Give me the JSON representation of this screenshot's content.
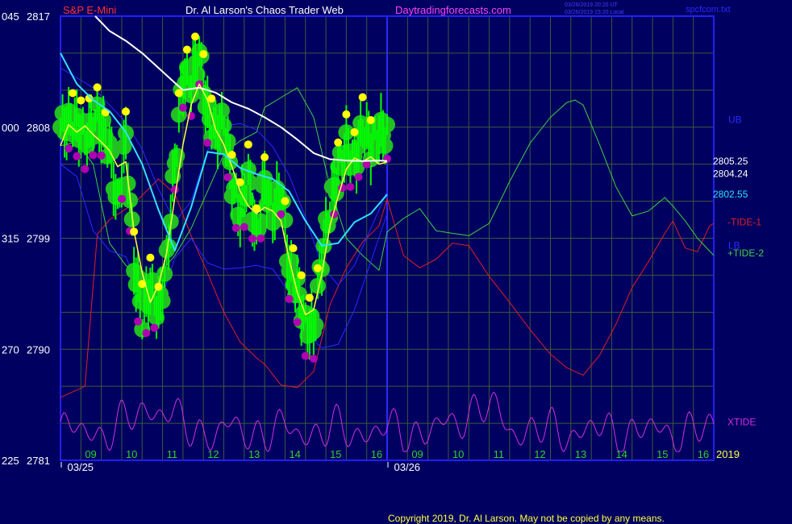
{
  "header": {
    "instrument": "S&P E-Mini",
    "author": "Dr. Al Larson's Chaos Trader Web",
    "site": "Daytradingforecasts.com",
    "timestamp_utc": "03/26/2019 20:20 UT",
    "timestamp_local": "03/26/2019 15:20 Local",
    "file": "spcfcom.txt"
  },
  "footer": {
    "copyright": "Copyright 2019, Dr. Al Larson. May not be copied by any means."
  },
  "colors": {
    "background": "#000060",
    "grid": "#3c5a3c",
    "frame": "#2020ff",
    "price_bars": "#00ff00",
    "price_glow": "#22c022",
    "high_dots": "#ffff00",
    "low_dots": "#b000b0",
    "ma_white": "#ffffff",
    "ma_cyan": "#30e0ff",
    "ma_yellow": "#ffff40",
    "band": "#2a2aff",
    "tide1": "#e02020",
    "tide2": "#40d040",
    "xtide": "#d030e0"
  },
  "chart_data": {
    "type": "line",
    "title": "S&P E-Mini",
    "ylim": [
      2781,
      2817
    ],
    "y_ticks": [
      {
        "left": "045",
        "right": "2817",
        "value": 2817
      },
      {
        "left": "000",
        "right": "2808",
        "value": 2808
      },
      {
        "left": "315",
        "right": "2799",
        "value": 2799
      },
      {
        "left": "270",
        "right": "2790",
        "value": 2790
      },
      {
        "left": "225",
        "right": "2781",
        "value": 2781
      }
    ],
    "xlim": [
      0,
      16
    ],
    "hour_ticks": [
      {
        "label": "09",
        "x": 1
      },
      {
        "label": "10",
        "x": 2
      },
      {
        "label": "11",
        "x": 3
      },
      {
        "label": "12",
        "x": 4
      },
      {
        "label": "13",
        "x": 5
      },
      {
        "label": "14",
        "x": 6
      },
      {
        "label": "15",
        "x": 7
      },
      {
        "label": "16",
        "x": 8
      },
      {
        "label": "09",
        "x": 9
      },
      {
        "label": "10",
        "x": 10
      },
      {
        "label": "11",
        "x": 11
      },
      {
        "label": "12",
        "x": 12
      },
      {
        "label": "13",
        "x": 13
      },
      {
        "label": "14",
        "x": 14
      },
      {
        "label": "15",
        "x": 15
      },
      {
        "label": "16",
        "x": 16
      }
    ],
    "date_labels": [
      {
        "label": "03/25",
        "x": 0.8
      },
      {
        "label": "03/26",
        "x": 8.8
      }
    ],
    "day_divider_x": 8,
    "year_label": "2019",
    "right_labels": [
      {
        "text": "UB",
        "value": 2808.6
      },
      {
        "text": "2805.25",
        "value": 2805.25
      },
      {
        "text": "2804.24",
        "value": 2804.24
      },
      {
        "text": "2802.55",
        "value": 2802.55
      },
      {
        "text": "-TIDE-1",
        "value": 2800.3
      },
      {
        "text": "LB",
        "value": 2798.4
      },
      {
        "text": "+TIDE-2",
        "value": 2797.8
      },
      {
        "text": "XTIDE",
        "value": 2784.1
      }
    ],
    "series": [
      {
        "name": "price",
        "x": [
          0,
          0.3,
          0.6,
          0.9,
          1.2,
          1.4,
          1.6,
          1.8,
          2.0,
          2.2,
          2.4,
          2.6,
          2.8,
          3.0,
          3.2,
          3.4,
          3.6,
          3.8,
          4.0,
          4.2,
          4.4,
          4.6,
          4.8,
          5.0,
          5.2,
          5.4,
          5.6,
          5.8,
          6.0,
          6.2,
          6.4,
          6.6,
          6.8,
          7.0,
          7.2,
          7.4,
          7.6,
          7.8,
          8.0
        ],
        "values": [
          2808,
          2808.5,
          2807.2,
          2808.8,
          2806.3,
          2801.5,
          2807,
          2797,
          2792.7,
          2795,
          2793,
          2797,
          2805,
          2812,
          2811.5,
          2814,
          2809,
          2807.5,
          2808.5,
          2803.5,
          2801,
          2804,
          2799,
          2803.5,
          2801,
          2803,
          2796.5,
          2794.8,
          2792,
          2791.5,
          2797.5,
          2801.5,
          2804.5,
          2806.5,
          2805,
          2808,
          2806.5,
          2807.5,
          2807.5
        ]
      },
      {
        "name": "",
        "x": [
          0,
          0.2,
          0.4,
          0.6,
          0.8,
          1.0,
          1.2,
          1.4,
          1.6,
          1.8,
          2.0,
          2.2,
          2.4,
          2.6,
          2.8,
          3.0,
          3.2,
          3.4,
          3.6,
          3.8,
          4.0,
          4.2,
          4.4,
          4.6,
          4.8,
          5.0,
          5.2,
          5.4,
          5.6,
          5.8,
          6.0,
          6.2,
          6.4,
          6.6,
          6.8,
          7.0,
          7.2,
          7.4,
          7.6,
          7.8,
          8.0
        ],
        "values": [
          2806.5,
          2808.2,
          2807.6,
          2808.1,
          2807.4,
          2806.8,
          2806.1,
          2804.8,
          2805.2,
          2799.6,
          2796.2,
          2793.8,
          2795.2,
          2797.8,
          2802.3,
          2806.6,
          2809.8,
          2811.5,
          2810.2,
          2807.8,
          2806.6,
          2804.8,
          2802.8,
          2801.6,
          2801.0,
          2801.5,
          2801.2,
          2800.4,
          2797.3,
          2794.6,
          2792.8,
          2793.2,
          2796.1,
          2800.0,
          2802.4,
          2804.6,
          2805.5,
          2805.2,
          2805.6,
          2805.0,
          2805.2
        ]
      },
      {
        "name": "",
        "x": [
          0,
          0.4,
          0.8,
          1.2,
          1.6,
          2.0,
          2.4,
          2.8,
          3.2,
          3.6,
          4.0,
          4.4,
          4.8,
          5.2,
          5.6,
          6.0,
          6.4,
          6.8,
          7.2,
          7.6,
          8.0
        ],
        "values": [
          2814,
          2811.5,
          2810.2,
          2809.3,
          2807.6,
          2805.0,
          2801.3,
          2798.0,
          2801.5,
          2806.0,
          2805.8,
          2804.7,
          2804.2,
          2803.8,
          2802.8,
          2800.4,
          2798.4,
          2798.6,
          2800.3,
          2801.0,
          2802.55
        ]
      },
      {
        "name": "",
        "x": [
          0.85,
          1.2,
          1.6,
          2.0,
          2.4,
          2.8,
          3.0,
          3.4,
          3.8,
          4.2,
          4.6,
          5.0,
          5.4,
          5.8,
          6.2,
          6.6,
          7.0,
          7.4,
          7.8,
          8.0
        ],
        "values": [
          2817,
          2815.8,
          2815.0,
          2814.0,
          2812.8,
          2811.6,
          2811.0,
          2811.2,
          2810.8,
          2810.0,
          2809.5,
          2808.8,
          2808.0,
          2807.0,
          2805.9,
          2805.4,
          2805.3,
          2805.25,
          2805.3,
          2805.25
        ]
      },
      {
        "name": "",
        "x": [
          0,
          0.4,
          0.8,
          1.2,
          1.6,
          2.0,
          2.4,
          2.8,
          3.2,
          3.6,
          4.0,
          4.4,
          4.8,
          5.2,
          5.6,
          6.0,
          6.4,
          6.8,
          7.2,
          7.6,
          8.0
        ],
        "values": [
          2812.8,
          2812.0,
          2811.2,
          2809.8,
          2808.4,
          2806.2,
          2803.0,
          2800.3,
          2802.0,
          2806.1,
          2808.1,
          2808.3,
          2807.8,
          2806.4,
          2804.1,
          2800.7,
          2796.8,
          2795.2,
          2796.8,
          2799.8,
          2802.8
        ]
      },
      {
        "name": "",
        "x": [
          0,
          0.4,
          0.8,
          1.2,
          1.6,
          2.0,
          2.4,
          2.8,
          3.2,
          3.6,
          4.0,
          4.4,
          4.8,
          5.2,
          5.6,
          6.0,
          6.4,
          6.8,
          7.2,
          7.6,
          8.0
        ],
        "values": [
          2805.0,
          2804.0,
          2799.6,
          2798.0,
          2797.5,
          2794.4,
          2793.3,
          2797.4,
          2799.0,
          2797.0,
          2796.5,
          2796.6,
          2796.8,
          2796.5,
          2794.6,
          2791.4,
          2790.1,
          2790.4,
          2793.2,
          2797.1,
          2801.0
        ]
      },
      {
        "name": "-TIDE-1",
        "x": [
          0,
          0.6,
          0.9,
          1.2,
          1.8,
          2.4,
          2.8,
          3.2,
          3.6,
          4.0,
          4.4,
          4.8,
          5.0,
          5.4,
          5.8,
          6.2,
          6.6,
          7.0,
          7.4,
          7.8,
          8.0,
          8.4,
          8.8,
          9.2,
          9.6,
          10.0,
          10.5,
          11.0,
          11.5,
          12.0,
          12.4,
          12.8,
          13.2,
          13.6,
          14.0,
          14.4,
          14.8,
          15.0,
          15.3,
          15.6,
          15.9,
          16.0
        ],
        "values": [
          2786.1,
          2787.0,
          2799.3,
          2800.5,
          2801.8,
          2803.8,
          2802.6,
          2799.2,
          2796.2,
          2793.0,
          2790.6,
          2789.3,
          2788.8,
          2787.1,
          2786.9,
          2788.2,
          2793.6,
          2796.6,
          2798.7,
          2800.0,
          2802.2,
          2797.6,
          2796.6,
          2797.3,
          2798.6,
          2798.4,
          2795.9,
          2793.8,
          2791.6,
          2789.6,
          2788.5,
          2787.9,
          2789.5,
          2792.0,
          2795.0,
          2797.1,
          2799.4,
          2800.4,
          2798.2,
          2797.9,
          2800.0,
          2800.2
        ]
      },
      {
        "name": "+TIDE-2",
        "x": [
          0,
          0.4,
          0.8,
          1.2,
          1.6,
          2.0,
          2.4,
          2.8,
          3.2,
          3.6,
          4.0,
          4.4,
          4.8,
          5.0,
          5.4,
          5.8,
          6.2,
          6.6,
          7.0,
          7.4,
          7.8,
          8.0,
          8.4,
          8.8,
          9.2,
          9.6,
          10.0,
          10.5,
          11.0,
          11.5,
          12.0,
          12.4,
          12.6,
          12.8,
          13.2,
          13.6,
          14.0,
          14.4,
          14.8,
          15.0,
          15.3,
          15.6,
          16.0
        ],
        "values": [
          2806.5,
          2806.8,
          2805.0,
          2798.6,
          2796.8,
          2795.9,
          2796.0,
          2797.6,
          2799.8,
          2802.8,
          2805.8,
          2806.9,
          2807.6,
          2809.6,
          2810.4,
          2811.2,
          2808.8,
          2803.2,
          2799.0,
          2797.6,
          2796.4,
          2799.5,
          2800.6,
          2801.4,
          2799.6,
          2799.4,
          2799.2,
          2800.2,
          2803.6,
          2806.7,
          2808.8,
          2810.0,
          2810.2,
          2809.8,
          2806.6,
          2803.2,
          2800.8,
          2801.2,
          2802.3,
          2801.6,
          2800.4,
          2799.0,
          2797.6
        ]
      }
    ]
  }
}
